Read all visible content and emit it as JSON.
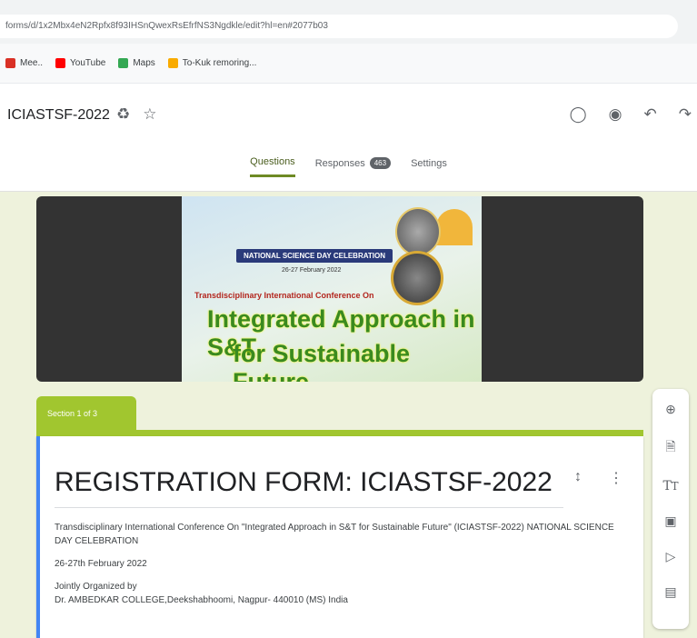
{
  "browser": {
    "url": "forms/d/1x2Mbx4eN2Rpfx8f93IHSnQwexRsEfrfNS3Ngdkle/edit?hl=en#2077b03"
  },
  "bookmarks": [
    {
      "label": "Mee..",
      "icon": "gmail-icon",
      "color": "#d93025"
    },
    {
      "label": "YouTube",
      "icon": "youtube-icon",
      "color": "#ff0000"
    },
    {
      "label": "Maps",
      "icon": "maps-icon",
      "color": "#34a853"
    },
    {
      "label": "To-Kuk remoring...",
      "icon": "bookmark-icon",
      "color": "#f9ab00"
    }
  ],
  "header": {
    "title": "ICIASTSF-2022",
    "tabs": [
      {
        "label": "Questions"
      },
      {
        "label": "Responses",
        "count": "463"
      },
      {
        "label": "Settings"
      }
    ]
  },
  "banner": {
    "science_day": "NATIONAL SCIENCE DAY CELEBRATION",
    "dates": "26-27 February 2022",
    "conference": "Transdisciplinary International Conference On",
    "headline1": "Integrated Approach in S&T",
    "headline2": "for Sustainable Future"
  },
  "section": {
    "label": "Section 1 of 3"
  },
  "form": {
    "title": "REGISTRATION FORM: ICIASTSF-2022",
    "desc1": "Transdisciplinary International Conference On \"Integrated Approach in S&T for Sustainable Future\" (ICIASTSF-2022) NATIONAL SCIENCE DAY CELEBRATION",
    "desc2": "26-27th February 2022",
    "desc3": "Jointly Organized by",
    "desc4": "Dr. AMBEDKAR COLLEGE,Deekshabhoomi, Nagpur- 440010 (MS) India"
  },
  "colors": {
    "accent": "#a1c62f",
    "card_border": "#4285f4"
  }
}
